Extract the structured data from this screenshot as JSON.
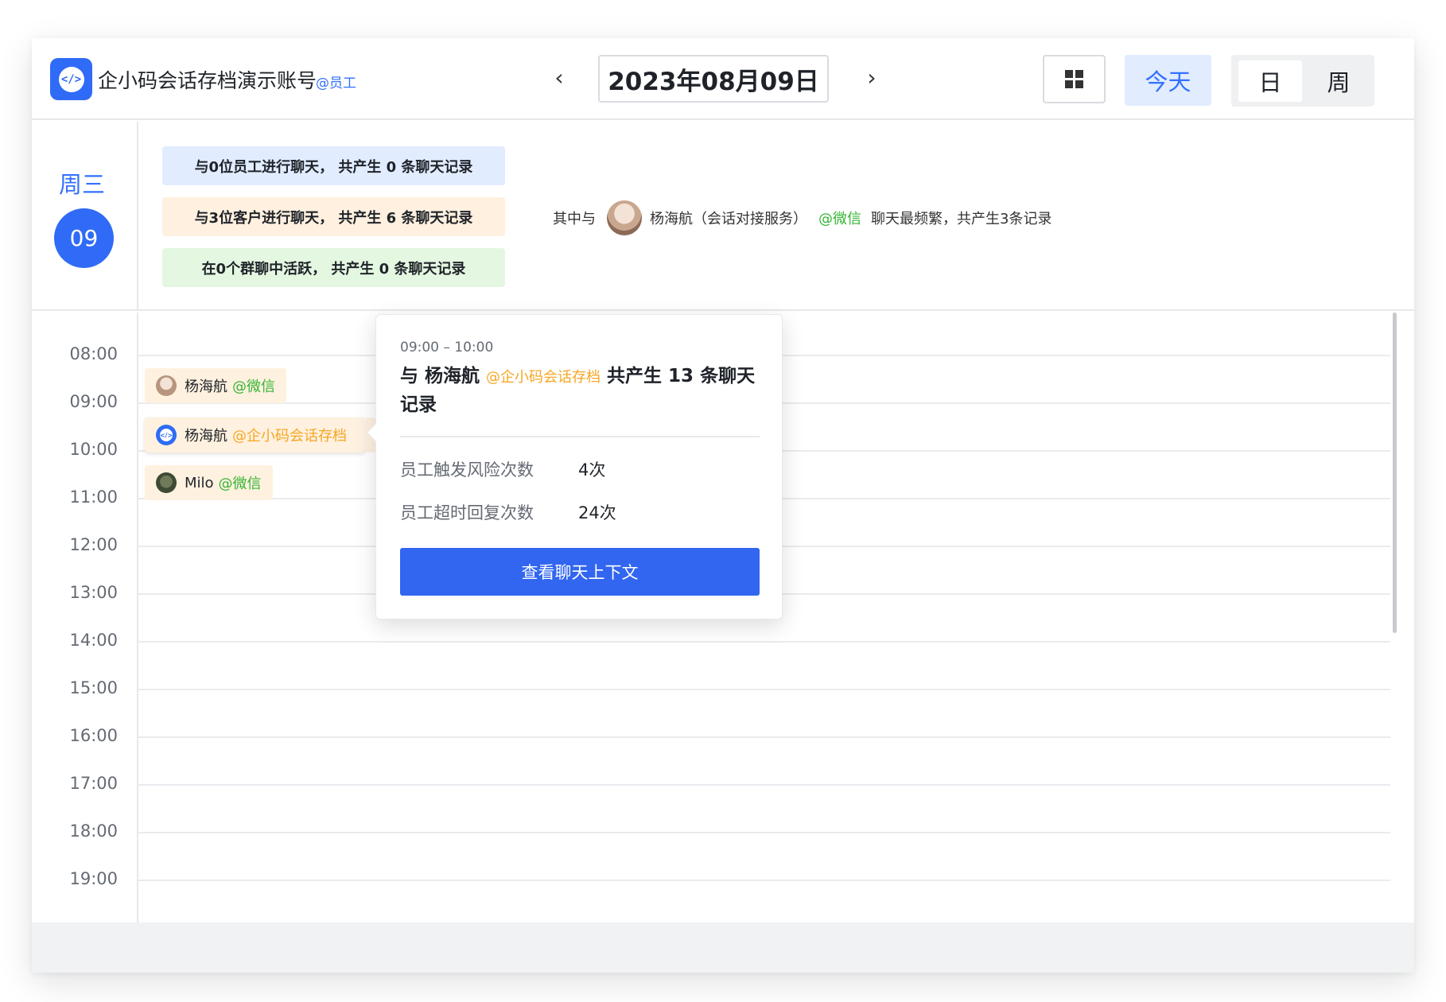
{
  "header": {
    "app_title": "企小码会话存档演示账号",
    "role_tag": "@员工",
    "prev_icon": "‹",
    "next_icon": "›",
    "date": "2023年08月09日",
    "today_label": "今天",
    "view_day_label": "日",
    "view_week_label": "周"
  },
  "summary": {
    "weekday": "周三",
    "day": "09",
    "stats": [
      "与0位员工进行聊天，  共产生 0 条聊天记录",
      "与3位客户进行聊天，  共产生 6 条聊天记录",
      "在0个群聊中活跃，  共产生 0 条聊天记录"
    ],
    "freq_prefix": "其中与",
    "freq_name": "杨海航（会话对接服务）",
    "freq_tag": "@微信",
    "freq_suffix": "聊天最频繁，共产生3条记录"
  },
  "hours": [
    "08:00",
    "09:00",
    "10:00",
    "11:00",
    "12:00",
    "13:00",
    "14:00",
    "15:00",
    "16:00",
    "17:00",
    "18:00",
    "19:00"
  ],
  "events": [
    {
      "name": "杨海航",
      "tag": "@微信"
    },
    {
      "name": "杨海航",
      "tag": "@企小码会话存档"
    },
    {
      "name": "Milo",
      "tag": "@微信"
    }
  ],
  "popover": {
    "time_range": "09:00 – 10:00",
    "title_prefix": "与 杨海航",
    "title_org": "@企小码会话存档",
    "title_suffix": "共产生 13 条聊天记录",
    "risk_label": "员工触发风险次数",
    "risk_value": "4次",
    "timeout_label": "员工超时回复次数",
    "timeout_value": "24次",
    "button_label": "查看聊天上下文"
  },
  "colors": {
    "brand": "#2f6bf6",
    "wechat_tag": "#34b534",
    "org_tag": "#f5a623"
  }
}
